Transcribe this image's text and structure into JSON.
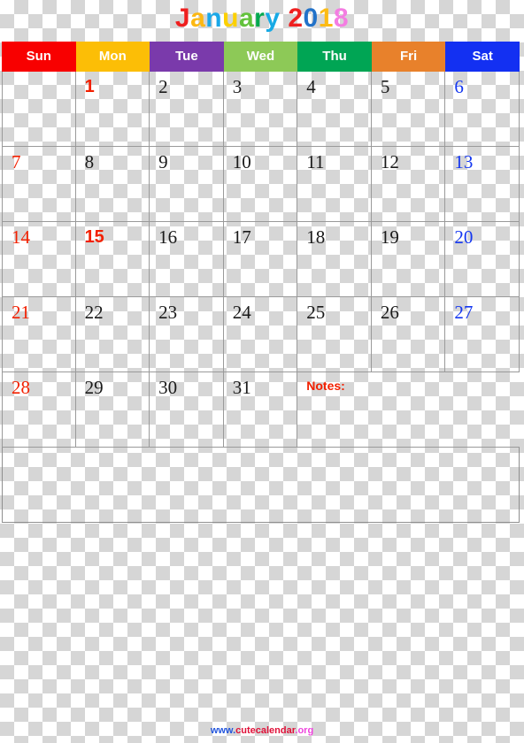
{
  "title": {
    "text": "January 2018",
    "letters": [
      {
        "ch": "J",
        "color": "#ef1f1f"
      },
      {
        "ch": "a",
        "color": "#fcb813"
      },
      {
        "ch": "n",
        "color": "#1aa8e8"
      },
      {
        "ch": "u",
        "color": "#fcd000"
      },
      {
        "ch": "a",
        "color": "#63c23c"
      },
      {
        "ch": "r",
        "color": "#00a94f"
      },
      {
        "ch": "y",
        "color": "#18aae5"
      },
      {
        "ch": " ",
        "color": "#000000"
      },
      {
        "ch": "2",
        "color": "#ef1f1f"
      },
      {
        "ch": "0",
        "color": "#2272c9"
      },
      {
        "ch": "1",
        "color": "#fcbb13"
      },
      {
        "ch": "8",
        "color": "#f47de2"
      }
    ]
  },
  "weekdays": [
    {
      "label": "Sun",
      "color": "#f80000"
    },
    {
      "label": "Mon",
      "color": "#fcbe06"
    },
    {
      "label": "Tue",
      "color": "#7a3aab"
    },
    {
      "label": "Wed",
      "color": "#8dc957"
    },
    {
      "label": "Thu",
      "color": "#00a554"
    },
    {
      "label": "Fri",
      "color": "#e8812b"
    },
    {
      "label": "Sat",
      "color": "#1330f2"
    }
  ],
  "month": "January",
  "year": "2018",
  "weeks": [
    [
      {
        "day": "",
        "type": "empty"
      },
      {
        "day": "1",
        "type": "holiday"
      },
      {
        "day": "2",
        "type": "weekday"
      },
      {
        "day": "3",
        "type": "weekday"
      },
      {
        "day": "4",
        "type": "weekday"
      },
      {
        "day": "5",
        "type": "weekday"
      },
      {
        "day": "6",
        "type": "saturday"
      }
    ],
    [
      {
        "day": "7",
        "type": "sunday"
      },
      {
        "day": "8",
        "type": "weekday"
      },
      {
        "day": "9",
        "type": "weekday"
      },
      {
        "day": "10",
        "type": "weekday"
      },
      {
        "day": "11",
        "type": "weekday"
      },
      {
        "day": "12",
        "type": "weekday"
      },
      {
        "day": "13",
        "type": "saturday"
      }
    ],
    [
      {
        "day": "14",
        "type": "sunday"
      },
      {
        "day": "15",
        "type": "holiday"
      },
      {
        "day": "16",
        "type": "weekday"
      },
      {
        "day": "17",
        "type": "weekday"
      },
      {
        "day": "18",
        "type": "weekday"
      },
      {
        "day": "19",
        "type": "weekday"
      },
      {
        "day": "20",
        "type": "saturday"
      }
    ],
    [
      {
        "day": "21",
        "type": "sunday"
      },
      {
        "day": "22",
        "type": "weekday"
      },
      {
        "day": "23",
        "type": "weekday"
      },
      {
        "day": "24",
        "type": "weekday"
      },
      {
        "day": "25",
        "type": "weekday"
      },
      {
        "day": "26",
        "type": "weekday"
      },
      {
        "day": "27",
        "type": "saturday"
      }
    ],
    [
      {
        "day": "28",
        "type": "sunday"
      },
      {
        "day": "29",
        "type": "weekday"
      },
      {
        "day": "30",
        "type": "weekday"
      },
      {
        "day": "31",
        "type": "weekday"
      },
      {
        "day": "",
        "type": "notes"
      },
      {
        "day": "",
        "type": "notes-span"
      },
      {
        "day": "",
        "type": "notes-span"
      }
    ]
  ],
  "notes_label": "Notes:",
  "footer": {
    "parts": [
      {
        "text": "www.",
        "color": "#2255dd"
      },
      {
        "text": "cutecalendar",
        "color": "#e01038"
      },
      {
        "text": ".org",
        "color": "#ee44dd"
      }
    ]
  }
}
